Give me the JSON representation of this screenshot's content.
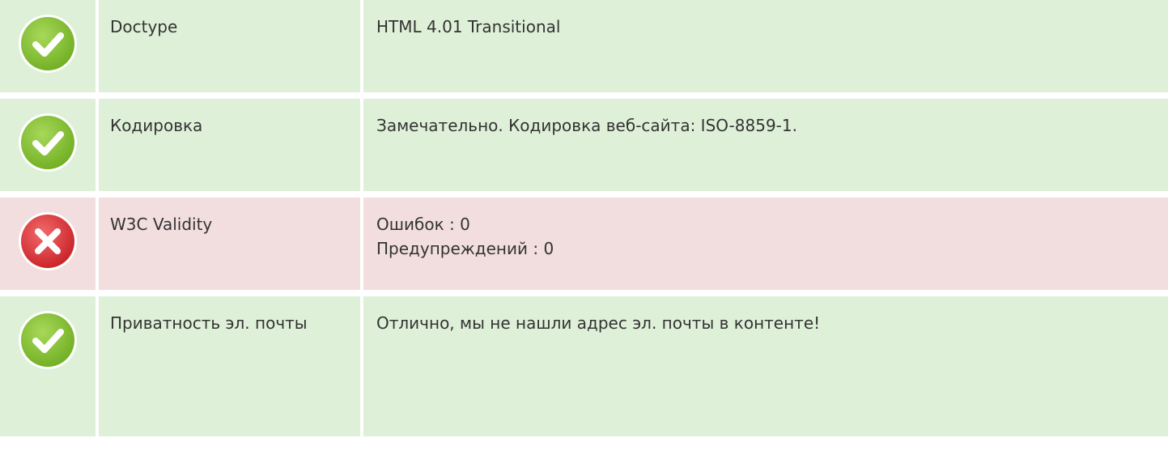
{
  "rows": [
    {
      "status": "ok",
      "icon": "check-circle-icon",
      "label": "Doctype",
      "lines": [
        "HTML 4.01 Transitional"
      ]
    },
    {
      "status": "ok",
      "icon": "check-circle-icon",
      "label": "Кодировка",
      "lines": [
        "Замечательно. Кодировка веб-сайта: ISO-8859-1."
      ]
    },
    {
      "status": "error",
      "icon": "error-circle-icon",
      "label": "W3C Validity",
      "lines": [
        "Ошибок : 0",
        "Предупреждений : 0"
      ]
    },
    {
      "status": "ok",
      "icon": "check-circle-icon",
      "label": "Приватность эл. почты",
      "lines": [
        "Отлично, мы не нашли адрес эл. почты в контенте!"
      ]
    }
  ],
  "colors": {
    "ok_bg": "#dff0d8",
    "error_bg": "#f2dede",
    "ok_icon": "#8cc63e",
    "error_icon": "#e0383e"
  }
}
